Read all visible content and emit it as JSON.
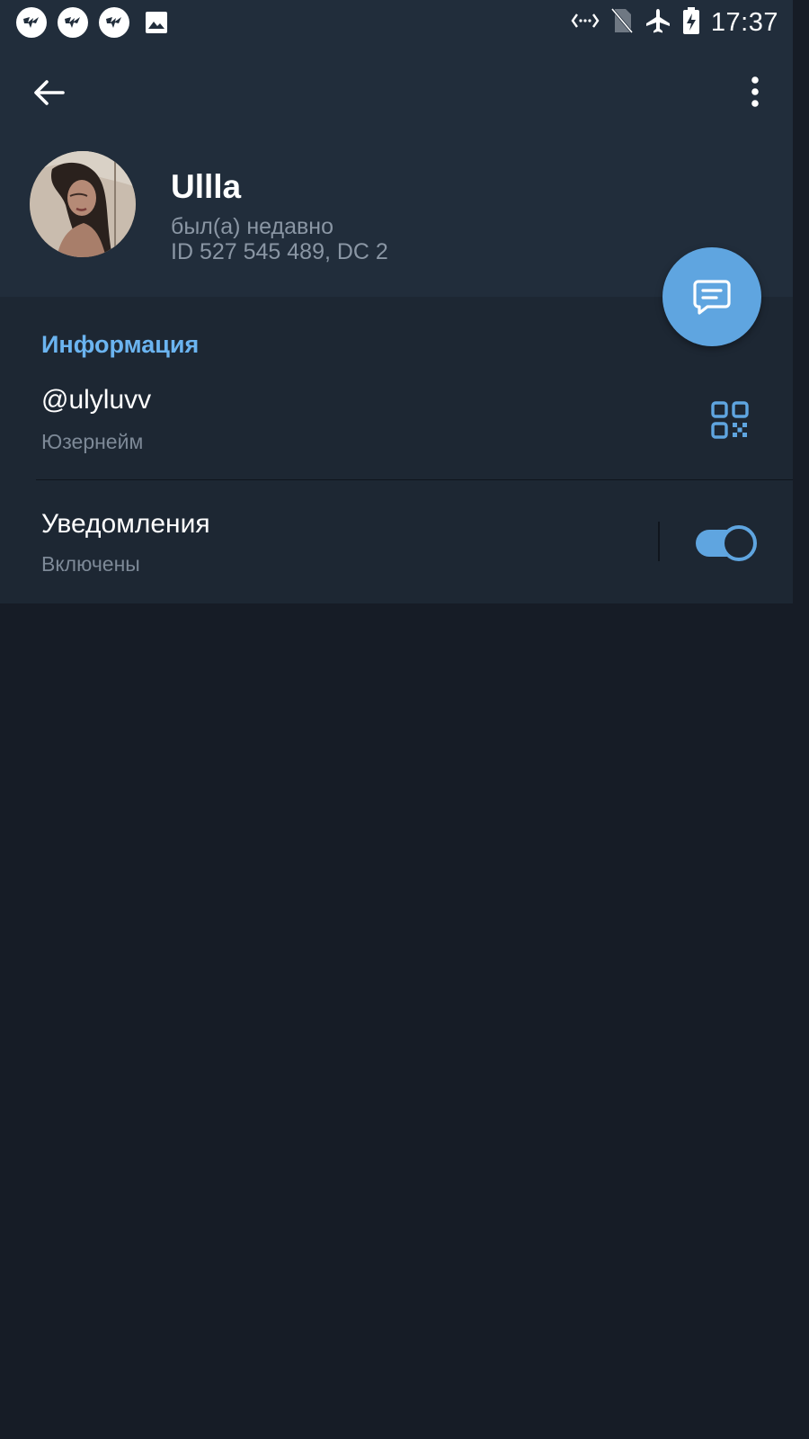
{
  "status_bar": {
    "time": "17:37",
    "left_icons": [
      "app-notification-icon",
      "app-notification-icon",
      "app-notification-icon",
      "image-icon"
    ],
    "right_icons": [
      "data-saver-icon",
      "no-sim-icon",
      "airplane-mode-icon",
      "battery-charging-icon"
    ]
  },
  "toolbar": {
    "back_icon": "arrow-left-icon",
    "menu_icon": "more-vertical-icon"
  },
  "profile": {
    "name": "Ullla",
    "last_seen": "был(а) недавно",
    "id_line": "ID 527 545 489, DC 2"
  },
  "fab": {
    "icon": "message-icon"
  },
  "info": {
    "header": "Информация",
    "username": "@ulyluvv",
    "username_caption": "Юзернейм",
    "qr_icon": "qr-code-icon",
    "notifications_title": "Уведомления",
    "notifications_caption": "Включены",
    "notifications_enabled": true
  },
  "colors": {
    "background": "#161c26",
    "header_bg": "#212d3b",
    "section_bg": "#1d2733",
    "accent": "#5fa5e0",
    "accent_text": "#6bb4f0",
    "secondary_text": "#7d8997"
  }
}
